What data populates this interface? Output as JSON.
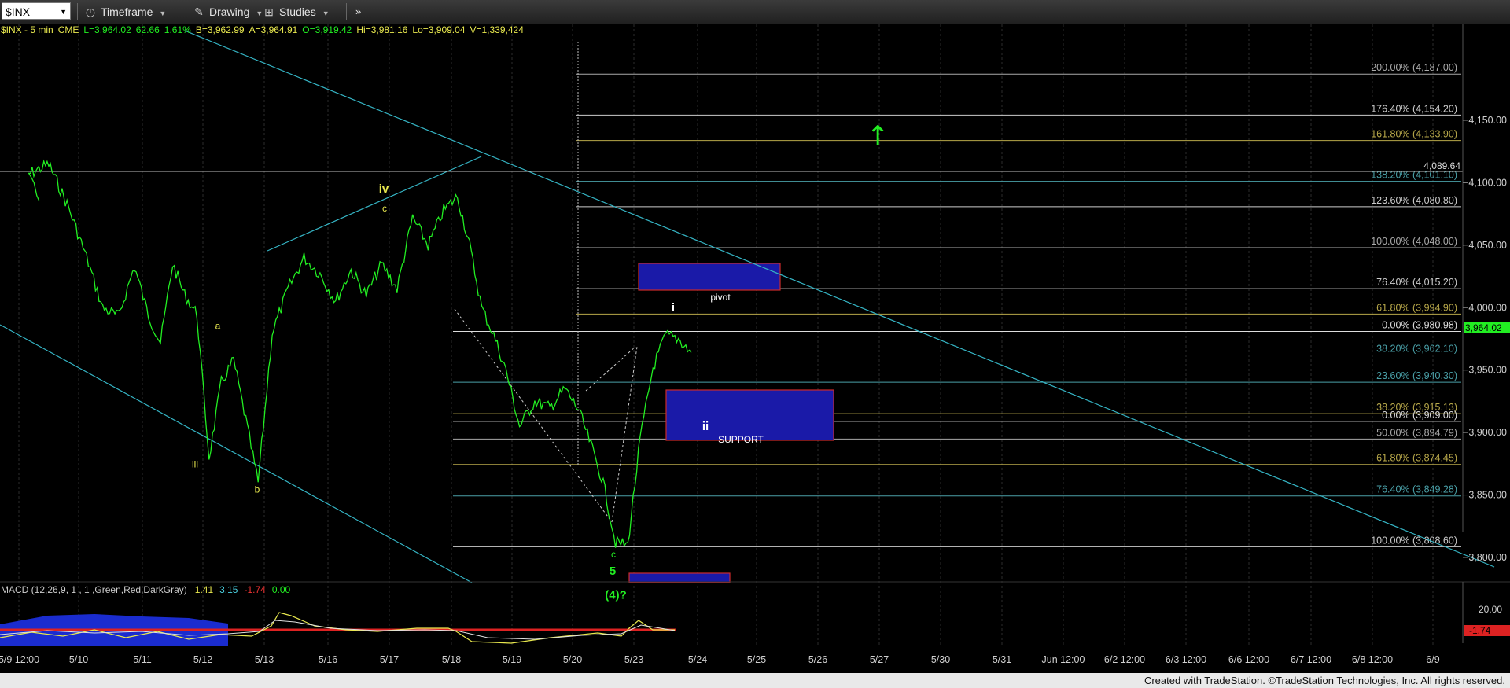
{
  "toolbar": {
    "symbol": "$INX",
    "timeframe_label": "Timeframe",
    "drawing_label": "Drawing",
    "studies_label": "Studies",
    "more_icon": "double-chevron-right-icon"
  },
  "header": {
    "symbol": "$INX - 5 min",
    "exchange": "CME",
    "last": "L=3,964.02",
    "change": "62.66",
    "change_pct": "1.61%",
    "bid": "B=3,962.99",
    "ask": "A=3,964.91",
    "open": "O=3,919.42",
    "high": "Hi=3,981.16",
    "low": "Lo=3,909.04",
    "volume": "V=1,339,424"
  },
  "macd": {
    "title": "MACD (12,26,9, 1 , 1 ,Green,Red,DarkGray)",
    "v1": "1.41",
    "v2": "3.15",
    "v3": "-1.74",
    "v4": "0.00",
    "axis_labels": [
      "20.00",
      "-1.74"
    ]
  },
  "price_tag": "3,964.02",
  "level_tag": "4,089.64",
  "footer": "Created with TradeStation. ©TradeStation Technologies, Inc. All rights reserved.",
  "colors": {
    "price": "#22ee22",
    "channel": "#35b4c4",
    "macd_line": "#e8e84e",
    "signal": "#e0e0e0",
    "hist": "#1a2ccf",
    "box": "#1a1aa8",
    "box_border": "#cc2a2a"
  },
  "chart_data": {
    "type": "line",
    "y_axis_ticks": [
      "4,150.00",
      "4,100.00",
      "4,050.00",
      "4,000.00",
      "3,950.00",
      "3,900.00",
      "3,850.00",
      "3,800.00"
    ],
    "ylim": [
      3760,
      4205
    ],
    "x_ticks": [
      "5/9 12:00",
      "5/10",
      "5/11",
      "5/12",
      "5/13",
      "5/16",
      "5/17",
      "5/18",
      "5/19",
      "5/20",
      "5/23",
      "5/24",
      "5/25",
      "5/26",
      "5/27",
      "5/30",
      "5/31",
      "Jun 12:00",
      "6/2 12:00",
      "6/3 12:00",
      "6/6 12:00",
      "6/7 12:00",
      "6/8 12:00",
      "6/9"
    ],
    "series": [
      {
        "x": [
          "5/9 12:00",
          "5/9",
          "5/9",
          "5/9",
          "5/10",
          "5/10",
          "5/10",
          "5/10",
          "5/11",
          "5/11",
          "5/11",
          "5/11",
          "5/11",
          "5/12",
          "5/12",
          "5/12",
          "5/12",
          "5/12",
          "5/13",
          "5/13",
          "5/13",
          "5/13",
          "5/16",
          "5/16",
          "5/16",
          "5/16",
          "5/17",
          "5/17",
          "5/17",
          "5/17",
          "5/18",
          "5/18",
          "5/18",
          "5/18",
          "5/18",
          "5/19",
          "5/19",
          "5/19",
          "5/19",
          "5/20",
          "5/20",
          "5/20",
          "5/20",
          "5/20",
          "5/23",
          "5/23",
          "5/23",
          "5/23",
          "5/23"
        ],
        "values": [
          4085,
          4107,
          4115,
          4080,
          4040,
          4000,
          3993,
          4033,
          3994,
          3972,
          4035,
          4010,
          3995,
          3880,
          3940,
          3958,
          3910,
          3860,
          3980,
          4015,
          4040,
          4027,
          4005,
          4030,
          4010,
          4035,
          4015,
          4072,
          4050,
          4078,
          4089,
          4050,
          4000,
          3978,
          3950,
          3905,
          3925,
          3920,
          3935,
          3918,
          3890,
          3860,
          3812,
          3810,
          3895,
          3952,
          3978,
          3975,
          3964
        ]
      }
    ],
    "fib_levels": [
      {
        "label": "200.00% (4,187.00)",
        "value": 4187.0,
        "color": "#aaaaaa"
      },
      {
        "label": "176.40% (4,154.20)",
        "value": 4154.2,
        "color": "#cccccc"
      },
      {
        "label": "161.80% (4,133.90)",
        "value": 4133.9,
        "color": "#b8a84a"
      },
      {
        "label": "138.20% (4,101.10)",
        "value": 4101.1,
        "color": "#4aa0a8"
      },
      {
        "label": "123.60% (4,080.80)",
        "value": 4080.8,
        "color": "#cccccc"
      },
      {
        "label": "100.00% (4,048.00)",
        "value": 4048.0,
        "color": "#aaaaaa"
      },
      {
        "label": "76.40% (4,015.20)",
        "value": 4015.2,
        "color": "#cccccc"
      },
      {
        "label": "61.80% (3,994.90)",
        "value": 3994.9,
        "color": "#b8a84a"
      },
      {
        "label": "0.00% (3,980.98)",
        "value": 3980.98,
        "color": "#dddddd"
      },
      {
        "label": "38.20% (3,962.10)",
        "value": 3962.1,
        "color": "#4aa0a8"
      },
      {
        "label": "23.60% (3,940.30)",
        "value": 3940.3,
        "color": "#4aa0a8"
      },
      {
        "label": "38.20% (3,915.13)",
        "value": 3915.13,
        "color": "#b8a84a"
      },
      {
        "label": "0.00% (3,909.00)",
        "value": 3909.0,
        "color": "#dddddd"
      },
      {
        "label": "50.00% (3,894.79)",
        "value": 3894.79,
        "color": "#aaaaaa"
      },
      {
        "label": "61.80% (3,874.45)",
        "value": 3874.45,
        "color": "#b8a84a"
      },
      {
        "label": "76.40% (3,849.28)",
        "value": 3849.28,
        "color": "#4aa0a8"
      },
      {
        "label": "100.00% (3,808.60)",
        "value": 3808.6,
        "color": "#cccccc"
      }
    ],
    "annotations": [
      {
        "text": "iv",
        "x": "5/17",
        "y": 4092,
        "color": "#e8e84e"
      },
      {
        "text": "c",
        "x": "5/17",
        "y": 4077,
        "color": "#e8e84e"
      },
      {
        "text": "a",
        "x": "5/12",
        "y": 3983,
        "color": "#e8e84e"
      },
      {
        "text": "iii",
        "x": "5/12",
        "y": 3872,
        "color": "#e8e84e"
      },
      {
        "text": "b",
        "x": "5/13",
        "y": 3852,
        "color": "#e8e84e"
      },
      {
        "text": "i",
        "x": "5/23",
        "y": 3997,
        "color": "#ffffff"
      },
      {
        "text": "pivot",
        "x": "5/24",
        "y": 4006,
        "color": "#ffffff"
      },
      {
        "text": "ii",
        "x": "5/24",
        "y": 3902,
        "color": "#ffffff"
      },
      {
        "text": "SUPPORT",
        "x": "5/24",
        "y": 3892,
        "color": "#ffffff"
      },
      {
        "text": "c",
        "x": "5/23",
        "y": 3800,
        "color": "#22ee22"
      },
      {
        "text": "5",
        "x": "5/23",
        "y": 3786,
        "color": "#22ee22"
      },
      {
        "text": "(4)?",
        "x": "5/23",
        "y": 3767,
        "color": "#22ee22"
      }
    ]
  }
}
